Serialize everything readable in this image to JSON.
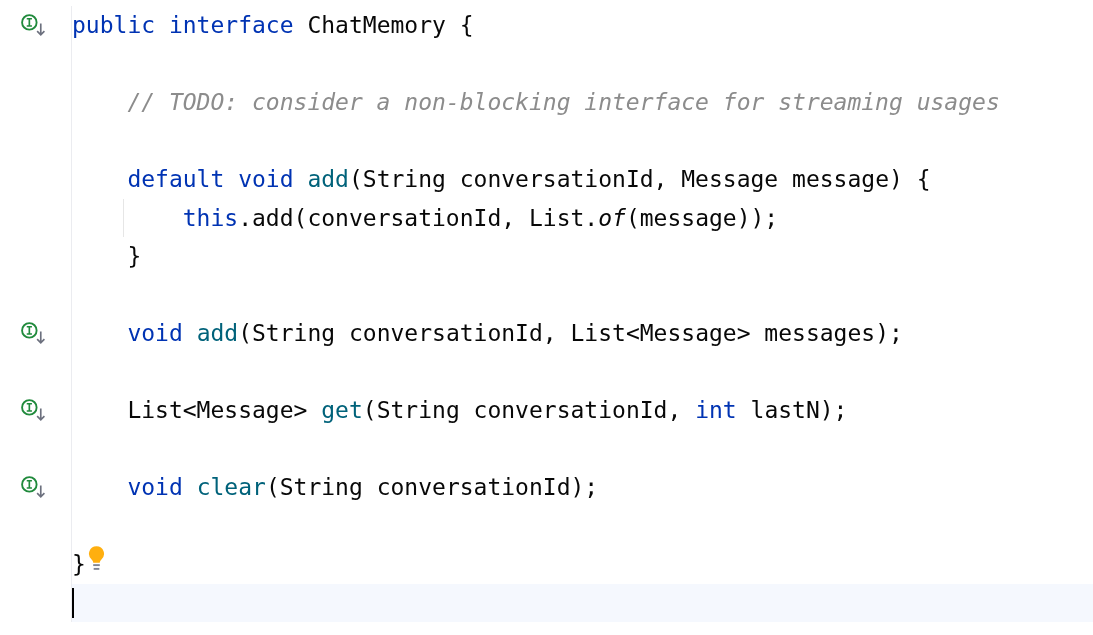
{
  "editor": {
    "lines": [
      {
        "kind": "code",
        "implemented_marker": true,
        "tokens": [
          {
            "kind": "keyword",
            "text": "public interface"
          },
          {
            "kind": "plain",
            "text": " ChatMemory {"
          }
        ],
        "children": [
          {
            "kind": "blank"
          },
          {
            "kind": "code",
            "tokens": [
              {
                "kind": "comment",
                "text": "// TODO: consider a non-blocking interface for streaming usages"
              }
            ]
          },
          {
            "kind": "blank"
          },
          {
            "kind": "code",
            "tokens": [
              {
                "kind": "keyword",
                "text": "default void "
              },
              {
                "kind": "declaration",
                "text": "add"
              },
              {
                "kind": "plain",
                "text": "(String conversationId, Message message) {"
              }
            ],
            "children": [
              {
                "kind": "code",
                "tokens": [
                  {
                    "kind": "keyword",
                    "text": "this"
                  },
                  {
                    "kind": "plain",
                    "text": ".add(conversationId, List."
                  },
                  {
                    "kind": "static_call",
                    "text": "of"
                  },
                  {
                    "kind": "plain",
                    "text": "(message));"
                  }
                ]
              }
            ]
          },
          {
            "kind": "code",
            "tokens": [
              {
                "kind": "plain",
                "text": "}"
              }
            ]
          },
          {
            "kind": "blank"
          },
          {
            "kind": "code",
            "implemented_marker": true,
            "tokens": [
              {
                "kind": "keyword",
                "text": "void "
              },
              {
                "kind": "declaration",
                "text": "add"
              },
              {
                "kind": "plain",
                "text": "(String conversationId, List<Message> messages);"
              }
            ]
          },
          {
            "kind": "blank"
          },
          {
            "kind": "code",
            "implemented_marker": true,
            "tokens": [
              {
                "kind": "plain",
                "text": "List<Message> "
              },
              {
                "kind": "declaration",
                "text": "get"
              },
              {
                "kind": "plain",
                "text": "(String conversationId, "
              },
              {
                "kind": "keyword",
                "text": "int"
              },
              {
                "kind": "plain",
                "text": " lastN);"
              }
            ]
          },
          {
            "kind": "blank"
          },
          {
            "kind": "code",
            "implemented_marker": true,
            "tokens": [
              {
                "kind": "keyword",
                "text": "void "
              },
              {
                "kind": "declaration",
                "text": "clear"
              },
              {
                "kind": "plain",
                "text": "(String conversationId);"
              }
            ]
          },
          {
            "kind": "blank"
          }
        ]
      },
      {
        "kind": "code",
        "intention_bulb": true,
        "tokens": [
          {
            "kind": "plain",
            "text": "}"
          }
        ]
      },
      {
        "kind": "blank",
        "current": true,
        "caret": true
      }
    ]
  }
}
